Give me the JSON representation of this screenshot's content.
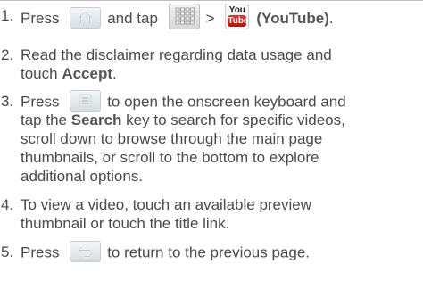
{
  "steps": [
    {
      "number": "1.",
      "parts": {
        "t1": "Press",
        "t2": "and tap",
        "t3": ">",
        "bold": "(YouTube)",
        "t4": "."
      },
      "icons": [
        "home-key",
        "apps-grid",
        "youtube"
      ],
      "youtube_icon_text": {
        "top": "You",
        "bottom": "Tube"
      }
    },
    {
      "number": "2.",
      "lines": [
        "Read the disclaimer regarding data usage and",
        "touch"
      ],
      "bold": "Accept",
      "end": "."
    },
    {
      "number": "3.",
      "t1": "Press",
      "t2": "to open the onscreen keyboard and",
      "l2_pre": "tap the",
      "l2_bold": "Search",
      "l2_post": "key to search for specific videos,",
      "lines_rest": [
        "scroll down to browse through the main page",
        "thumbnails, or scroll to the bottom to explore",
        "additional options."
      ],
      "icons": [
        "menu-key"
      ]
    },
    {
      "number": "4.",
      "lines": [
        "To view a video, touch an available preview",
        "thumbnail or touch the title link."
      ]
    },
    {
      "number": "5.",
      "t1": "Press",
      "t2": "to return to the previous page.",
      "icons": [
        "back-key"
      ]
    }
  ],
  "colors": {
    "text": "#4a4a4a",
    "rule": "#bdbdbd",
    "youtube_red": "#d1221a"
  }
}
